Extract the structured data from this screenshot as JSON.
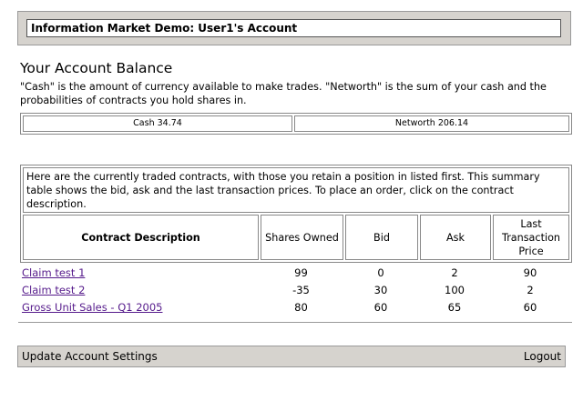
{
  "header": {
    "title": "Information Market Demo: User1's Account"
  },
  "balance": {
    "heading": "Your Account Balance",
    "description": "\"Cash\" is the amount of currency available to make trades. \"Networth\" is the sum of your cash and the probabilities of contracts you hold shares in.",
    "cash": "Cash 34.74",
    "networth": "Networth 206.14"
  },
  "contracts": {
    "intro": "Here are the currently traded contracts, with those you retain a position in listed first. This summary table shows the bid, ask and the last transaction prices. To place an order, click on the contract description.",
    "headers": {
      "description": "Contract Description",
      "shares": "Shares Owned",
      "bid": "Bid",
      "ask": "Ask",
      "last": "Last Transaction Price"
    },
    "rows": [
      {
        "name": "Claim test 1",
        "shares": "99",
        "bid": "0",
        "ask": "2",
        "last": "90"
      },
      {
        "name": "Claim test 2",
        "shares": "-35",
        "bid": "30",
        "ask": "100",
        "last": "2"
      },
      {
        "name": "Gross Unit Sales - Q1 2005",
        "shares": "80",
        "bid": "60",
        "ask": "65",
        "last": "60"
      }
    ]
  },
  "footer": {
    "update_label": "Update Account Settings",
    "logout_label": "Logout"
  },
  "colors": {
    "link": "#551a8b",
    "bar_background": "#d6d3ce"
  }
}
